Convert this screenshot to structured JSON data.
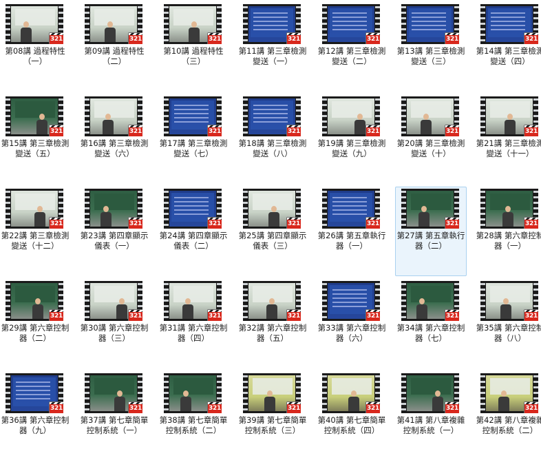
{
  "badge_text": "321",
  "colors": {
    "selection_bg": "#eaf4fc",
    "selection_border": "#a9d1ef",
    "badge_red": "#d8281d"
  },
  "items": [
    {
      "label": "第08講 過程特性（一）",
      "scene": "screen"
    },
    {
      "label": "第09講 過程特性（二）",
      "scene": "screen"
    },
    {
      "label": "第10講 過程特性（三）",
      "scene": "screen"
    },
    {
      "label": "第11講 第三章檢測變送（一）",
      "scene": "slide"
    },
    {
      "label": "第12講 第三章檢測變送（二）",
      "scene": "slide"
    },
    {
      "label": "第13講 第三章檢測變送（三）",
      "scene": "slide"
    },
    {
      "label": "第14講 第三章檢測變送（四）",
      "scene": "slide"
    },
    {
      "label": "第15講 第三章檢測變送（五）",
      "scene": "board"
    },
    {
      "label": "第16講 第三章檢測變送（六）",
      "scene": "screen"
    },
    {
      "label": "第17講 第三章檢測變送（七）",
      "scene": "slide"
    },
    {
      "label": "第18講 第三章檢測變送（八）",
      "scene": "slide"
    },
    {
      "label": "第19講 第三章檢測變送（九）",
      "scene": "screen"
    },
    {
      "label": "第20講 第三章檢測變送（十）",
      "scene": "screen"
    },
    {
      "label": "第21講 第三章檢測變送（十一）",
      "scene": "screen"
    },
    {
      "label": "第22講 第三章檢測變送（十二）",
      "scene": "screen"
    },
    {
      "label": "第23講 第四章顯示儀表（一）",
      "scene": "board"
    },
    {
      "label": "第24講 第四章顯示儀表（二）",
      "scene": "slide"
    },
    {
      "label": "第25講 第四章顯示儀表（三）",
      "scene": "screen"
    },
    {
      "label": "第26講 第五章執行器（一）",
      "scene": "slide"
    },
    {
      "label": "第27講 第五章執行器（二）",
      "scene": "board"
    },
    {
      "label": "第28講 第六章控制器（一）",
      "scene": "board"
    },
    {
      "label": "第29講 第六章控制器（二）",
      "scene": "board"
    },
    {
      "label": "第30講 第六章控制器（三）",
      "scene": "screen"
    },
    {
      "label": "第31講 第六章控制器（四）",
      "scene": "screen"
    },
    {
      "label": "第32講 第六章控制器（五）",
      "scene": "screen"
    },
    {
      "label": "第33講 第六章控制器（六）",
      "scene": "slide"
    },
    {
      "label": "第34講 第六章控制器（七）",
      "scene": "board"
    },
    {
      "label": "第35講 第六章控制器（八）",
      "scene": "screen"
    },
    {
      "label": "第36講 第六章控制器（九）",
      "scene": "slide"
    },
    {
      "label": "第37講 第七章簡單控制系統（一）",
      "scene": "board"
    },
    {
      "label": "第38講 第七章簡單控制系統（二）",
      "scene": "board"
    },
    {
      "label": "第39講 第七章簡單控制系統（三）",
      "scene": "yellow"
    },
    {
      "label": "第40講 第七章簡單控制系統（四）",
      "scene": "yellow"
    },
    {
      "label": "第41講 第八章複雜控制系統（一）",
      "scene": "board"
    },
    {
      "label": "第42講 第八章複雜控制系統（二）",
      "scene": "yellow"
    }
  ],
  "selected_index": 19
}
